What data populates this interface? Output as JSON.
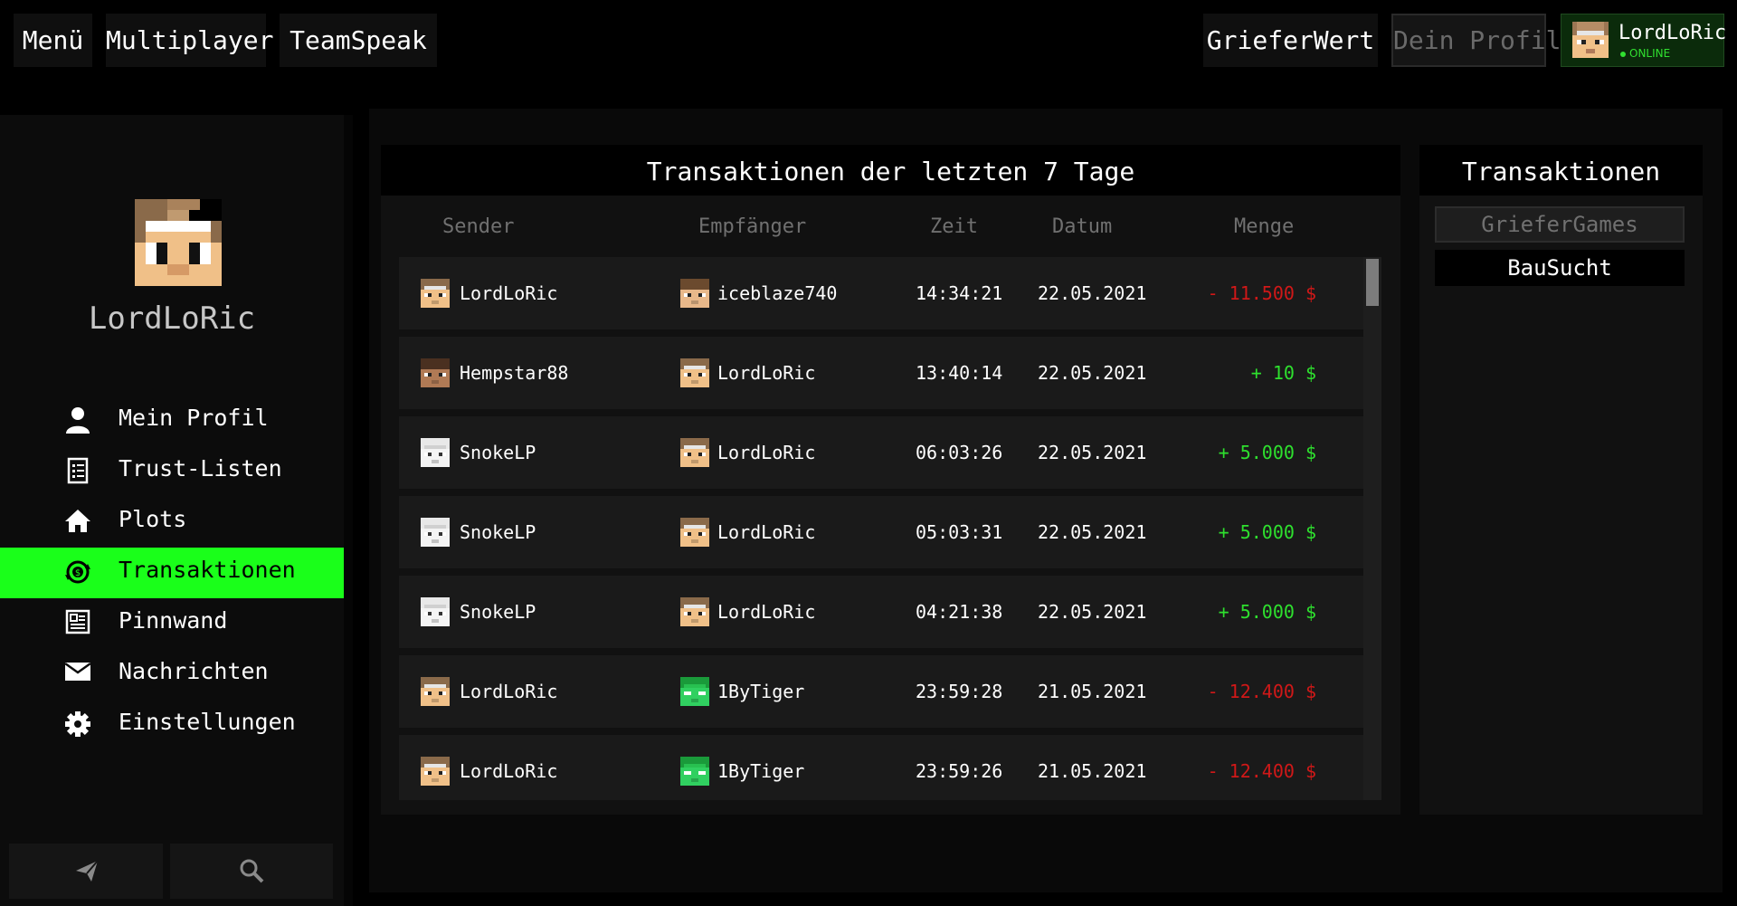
{
  "topnav": {
    "left": [
      "Menü",
      "Multiplayer",
      "TeamSpeak"
    ],
    "griefer_wert": "GrieferWert",
    "dein_profil": "Dein Profil",
    "user": {
      "name": "LordLoRic",
      "status": "ONLINE"
    }
  },
  "sidebar": {
    "username": "LordLoRic",
    "items": [
      {
        "label": "Mein Profil",
        "icon": "user-icon"
      },
      {
        "label": "Trust-Listen",
        "icon": "list-icon"
      },
      {
        "label": "Plots",
        "icon": "home-icon"
      },
      {
        "label": "Transaktionen",
        "icon": "money-cycle-icon",
        "active": true
      },
      {
        "label": "Pinnwand",
        "icon": "board-icon"
      },
      {
        "label": "Nachrichten",
        "icon": "mail-icon"
      },
      {
        "label": "Einstellungen",
        "icon": "gear-icon"
      }
    ],
    "bottom": [
      "send-icon",
      "search-icon"
    ]
  },
  "transactions": {
    "title": "Transaktionen der letzten 7 Tage",
    "columns": [
      "Sender",
      "Empfänger",
      "Zeit",
      "Datum",
      "Menge"
    ],
    "rows": [
      {
        "sender": "LordLoRic",
        "receiver": "iceblaze740",
        "time": "14:34:21",
        "date": "22.05.2021",
        "amount": "- 11.500 $",
        "sign": "neg"
      },
      {
        "sender": "Hempstar88",
        "receiver": "LordLoRic",
        "time": "13:40:14",
        "date": "22.05.2021",
        "amount": "+ 10 $",
        "sign": "pos"
      },
      {
        "sender": "SnokeLP",
        "receiver": "LordLoRic",
        "time": "06:03:26",
        "date": "22.05.2021",
        "amount": "+ 5.000 $",
        "sign": "pos"
      },
      {
        "sender": "SnokeLP",
        "receiver": "LordLoRic",
        "time": "05:03:31",
        "date": "22.05.2021",
        "amount": "+ 5.000 $",
        "sign": "pos"
      },
      {
        "sender": "SnokeLP",
        "receiver": "LordLoRic",
        "time": "04:21:38",
        "date": "22.05.2021",
        "amount": "+ 5.000 $",
        "sign": "pos"
      },
      {
        "sender": "LordLoRic",
        "receiver": "1ByTiger",
        "time": "23:59:28",
        "date": "21.05.2021",
        "amount": "- 12.400 $",
        "sign": "neg"
      },
      {
        "sender": "LordLoRic",
        "receiver": "1ByTiger",
        "time": "23:59:26",
        "date": "21.05.2021",
        "amount": "- 12.400 $",
        "sign": "neg"
      }
    ]
  },
  "servers": {
    "title": "Transaktionen",
    "items": [
      "GrieferGames",
      "BauSucht"
    ],
    "selected": "GrieferGames"
  },
  "colors": {
    "accent": "#1aff1a",
    "negative": "#d01818",
    "positive": "#2ee02e"
  }
}
